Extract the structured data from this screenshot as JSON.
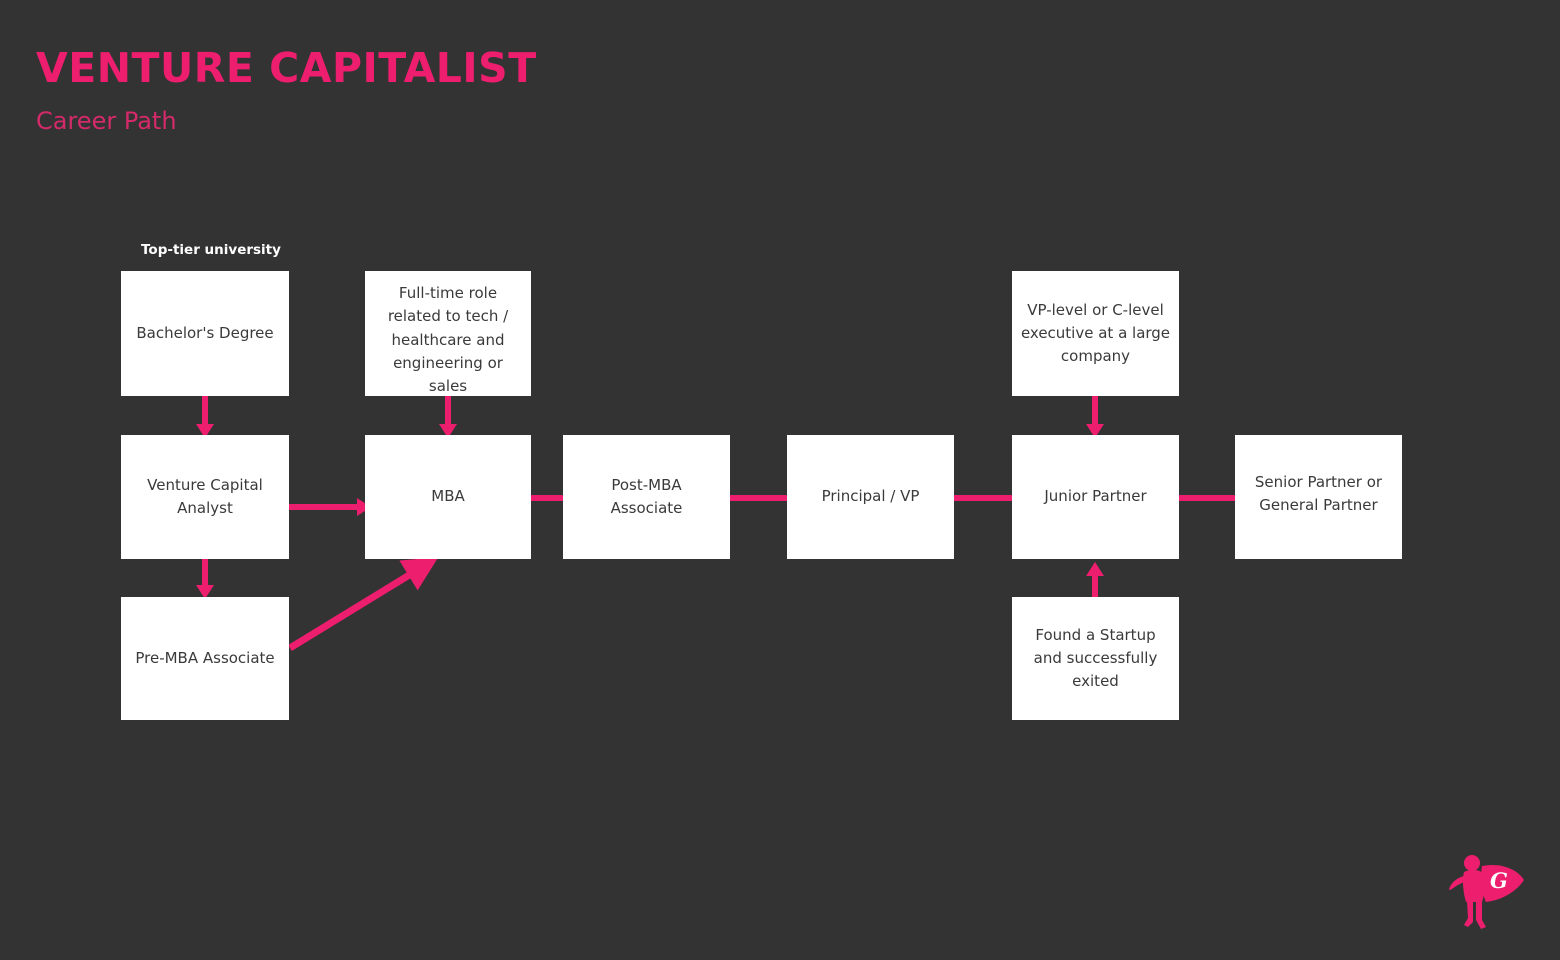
{
  "header": {
    "title": "VENTURE CAPITALIST",
    "subtitle": "Career Path",
    "title_color": "#ED1E6E",
    "subtitle_color": "#D42A69"
  },
  "theme": {
    "background": "#333333",
    "accent": "#ED1E6E",
    "node_fill": "#FFFFFF",
    "node_text": "#3A3A3A",
    "caption_text": "#FFFFFF"
  },
  "captions": [
    {
      "id": "top-tier-university",
      "text": "Top-tier university"
    }
  ],
  "nodes": [
    {
      "id": "bachelors-degree",
      "text": "Bachelor's Degree"
    },
    {
      "id": "full-time-role",
      "text": "Full-time role\nrelated to tech /\nhealthcare and\nengineering or\nsales"
    },
    {
      "id": "vp-c-level-executive",
      "text": "VP-level or C-level\nexecutive at a large\ncompany"
    },
    {
      "id": "venture-capital-analyst",
      "text": "Venture Capital\nAnalyst"
    },
    {
      "id": "mba",
      "text": "MBA"
    },
    {
      "id": "post-mba-associate",
      "text": "Post-MBA\nAssociate"
    },
    {
      "id": "principal-vp",
      "text": "Principal / VP"
    },
    {
      "id": "junior-partner",
      "text": "Junior Partner"
    },
    {
      "id": "senior-general-partner",
      "text": "Senior Partner or\nGeneral Partner"
    },
    {
      "id": "pre-mba-associate",
      "text": "Pre-MBA Associate"
    },
    {
      "id": "found-a-startup",
      "text": "Found a Startup\nand successfully\nexited"
    }
  ],
  "connectors": [
    {
      "id": "bachelors-to-analyst",
      "from": "bachelors-degree",
      "to": "venture-capital-analyst",
      "style": "arrow-down"
    },
    {
      "id": "fulltime-to-mba",
      "from": "full-time-role",
      "to": "mba",
      "style": "arrow-down"
    },
    {
      "id": "vpexec-to-junior-partner",
      "from": "vp-c-level-executive",
      "to": "junior-partner",
      "style": "arrow-down"
    },
    {
      "id": "analyst-to-mba",
      "from": "venture-capital-analyst",
      "to": "mba",
      "style": "arrow-right"
    },
    {
      "id": "analyst-to-premba",
      "from": "venture-capital-analyst",
      "to": "pre-mba-associate",
      "style": "arrow-down"
    },
    {
      "id": "premba-to-mba",
      "from": "pre-mba-associate",
      "to": "mba",
      "style": "arrow-diagonal"
    },
    {
      "id": "mba-to-post-mba",
      "from": "mba",
      "to": "post-mba-associate",
      "style": "line"
    },
    {
      "id": "post-mba-to-principal",
      "from": "post-mba-associate",
      "to": "principal-vp",
      "style": "line"
    },
    {
      "id": "principal-to-junior-partner",
      "from": "principal-vp",
      "to": "junior-partner",
      "style": "line"
    },
    {
      "id": "junior-to-senior-partner",
      "from": "junior-partner",
      "to": "senior-general-partner",
      "style": "line"
    },
    {
      "id": "startup-to-junior-partner",
      "from": "found-a-startup",
      "to": "junior-partner",
      "style": "arrow-up"
    }
  ],
  "logo": {
    "id": "superhero-logo",
    "letter": "G",
    "color": "#ED1E6E"
  }
}
